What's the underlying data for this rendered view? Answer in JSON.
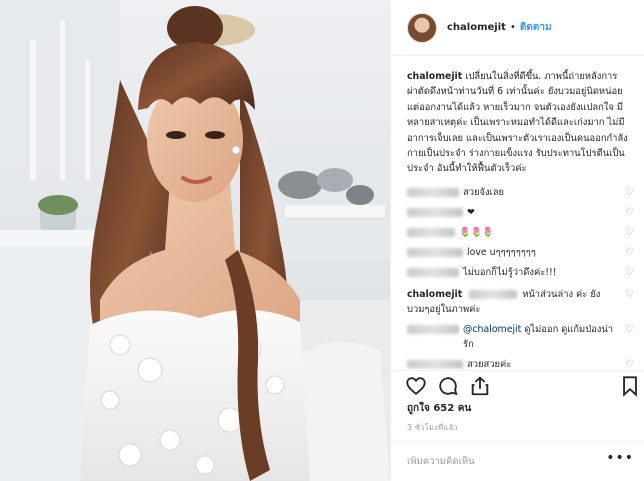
{
  "post": {
    "username": "chalomejit",
    "separator": "•",
    "follow_label": "ติดตาม",
    "caption_user": "chalomejit",
    "caption_text": " เปลี่ยนในสิ่งที่ดีขึ้น. ภาพนี้ถ่ายหลังการผ่าตัดดึงหน้าท่านวันที่ 6 เท่านั้นค่ะ ยังบวมอยู่นิดหน่อยแต่ออกงานได้แล้ว หายเร็วมาก จนตัวเองยังแปลกใจ มีหลายสาเหตุค่ะ เป็นเพราะหมอทำได้ดีและเก่งมาก ไม่มีอาการเจ็บเลย และเป็นเพราะตัวเราเองเป็นคนออกกำลังกายเป็นประจำ ร่างกายแข็งแรง รับประทานโปรตีนเป็นประจำ อันนี้ทำให้ฟื้นตัวเร็วค่ะ",
    "comments": [
      {
        "text": "สวยจังเลย"
      },
      {
        "text": "❤"
      },
      {
        "text": "🌷🌷🌷"
      },
      {
        "text": "love uๆๆๆๆๆๆๆๆ"
      },
      {
        "text": "ไม่บอกก็ไม่รู้ว่าดึงค่ะ!!!"
      }
    ],
    "owner_reply": {
      "user": "chalomejit",
      "text": " หน้าส่วนล่าง ค่ะ ยังบวมๆอยู่ในภาพค่ะ"
    },
    "mention_reply": {
      "mention": "@chalomejit",
      "text": " ดูไม่ออก ดูแก้มป่องน่ารัก"
    },
    "last_comment": "สวยสวยค่ะ",
    "likes": "ถูกใจ 652 คน",
    "time": "3 ชั่วโมงที่แล้ว",
    "add_comment_placeholder": "เพิ่มความคิดเห็น",
    "more_label": "•••"
  },
  "colors": {
    "link": "#3897f0",
    "text": "#262626",
    "muted": "#999999",
    "border": "#efefef"
  },
  "icons": [
    "heart-icon",
    "comment-icon",
    "share-icon",
    "bookmark-icon",
    "more-options-icon"
  ]
}
